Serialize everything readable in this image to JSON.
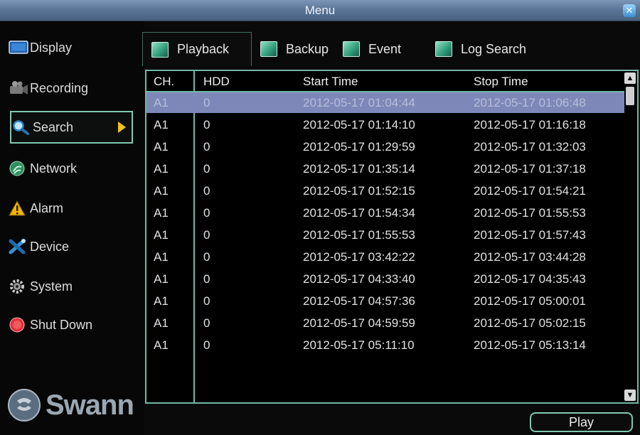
{
  "window": {
    "title": "Menu",
    "close_icon": "close-icon"
  },
  "sidebar": {
    "items": [
      {
        "label": "Display",
        "icon": "display-icon"
      },
      {
        "label": "Recording",
        "icon": "recording-icon"
      },
      {
        "label": "Search",
        "icon": "search-icon",
        "active": true
      },
      {
        "label": "Network",
        "icon": "network-icon"
      },
      {
        "label": "Alarm",
        "icon": "alarm-icon"
      },
      {
        "label": "Device",
        "icon": "device-icon"
      },
      {
        "label": "System",
        "icon": "system-icon"
      },
      {
        "label": "Shut Down",
        "icon": "shutdown-icon"
      }
    ],
    "logo": "Swann"
  },
  "tabs": [
    {
      "label": "Playback",
      "active": true
    },
    {
      "label": "Backup"
    },
    {
      "label": "Event"
    },
    {
      "label": "Log Search"
    }
  ],
  "table": {
    "columns": [
      "CH.",
      "HDD",
      "Start Time",
      "Stop Time"
    ],
    "rows": [
      [
        "A1",
        "0",
        "2012-05-17 01:04:44",
        "2012-05-17 01:06:48"
      ],
      [
        "A1",
        "0",
        "2012-05-17 01:14:10",
        "2012-05-17 01:16:18"
      ],
      [
        "A1",
        "0",
        "2012-05-17 01:29:59",
        "2012-05-17 01:32:03"
      ],
      [
        "A1",
        "0",
        "2012-05-17 01:35:14",
        "2012-05-17 01:37:18"
      ],
      [
        "A1",
        "0",
        "2012-05-17 01:52:15",
        "2012-05-17 01:54:21"
      ],
      [
        "A1",
        "0",
        "2012-05-17 01:54:34",
        "2012-05-17 01:55:53"
      ],
      [
        "A1",
        "0",
        "2012-05-17 01:55:53",
        "2012-05-17 01:57:43"
      ],
      [
        "A1",
        "0",
        "2012-05-17 03:42:22",
        "2012-05-17 03:44:28"
      ],
      [
        "A1",
        "0",
        "2012-05-17 04:33:40",
        "2012-05-17 04:35:43"
      ],
      [
        "A1",
        "0",
        "2012-05-17 04:57:36",
        "2012-05-17 05:00:01"
      ],
      [
        "A1",
        "0",
        "2012-05-17 04:59:59",
        "2012-05-17 05:02:15"
      ],
      [
        "A1",
        "0",
        "2012-05-17 05:11:10",
        "2012-05-17 05:13:14"
      ]
    ],
    "selected_row": 0
  },
  "actions": {
    "play_label": "Play"
  },
  "colors": {
    "accent": "#6fb9a6",
    "selection": "#7e88b8",
    "titlebar": "#5c7698"
  }
}
